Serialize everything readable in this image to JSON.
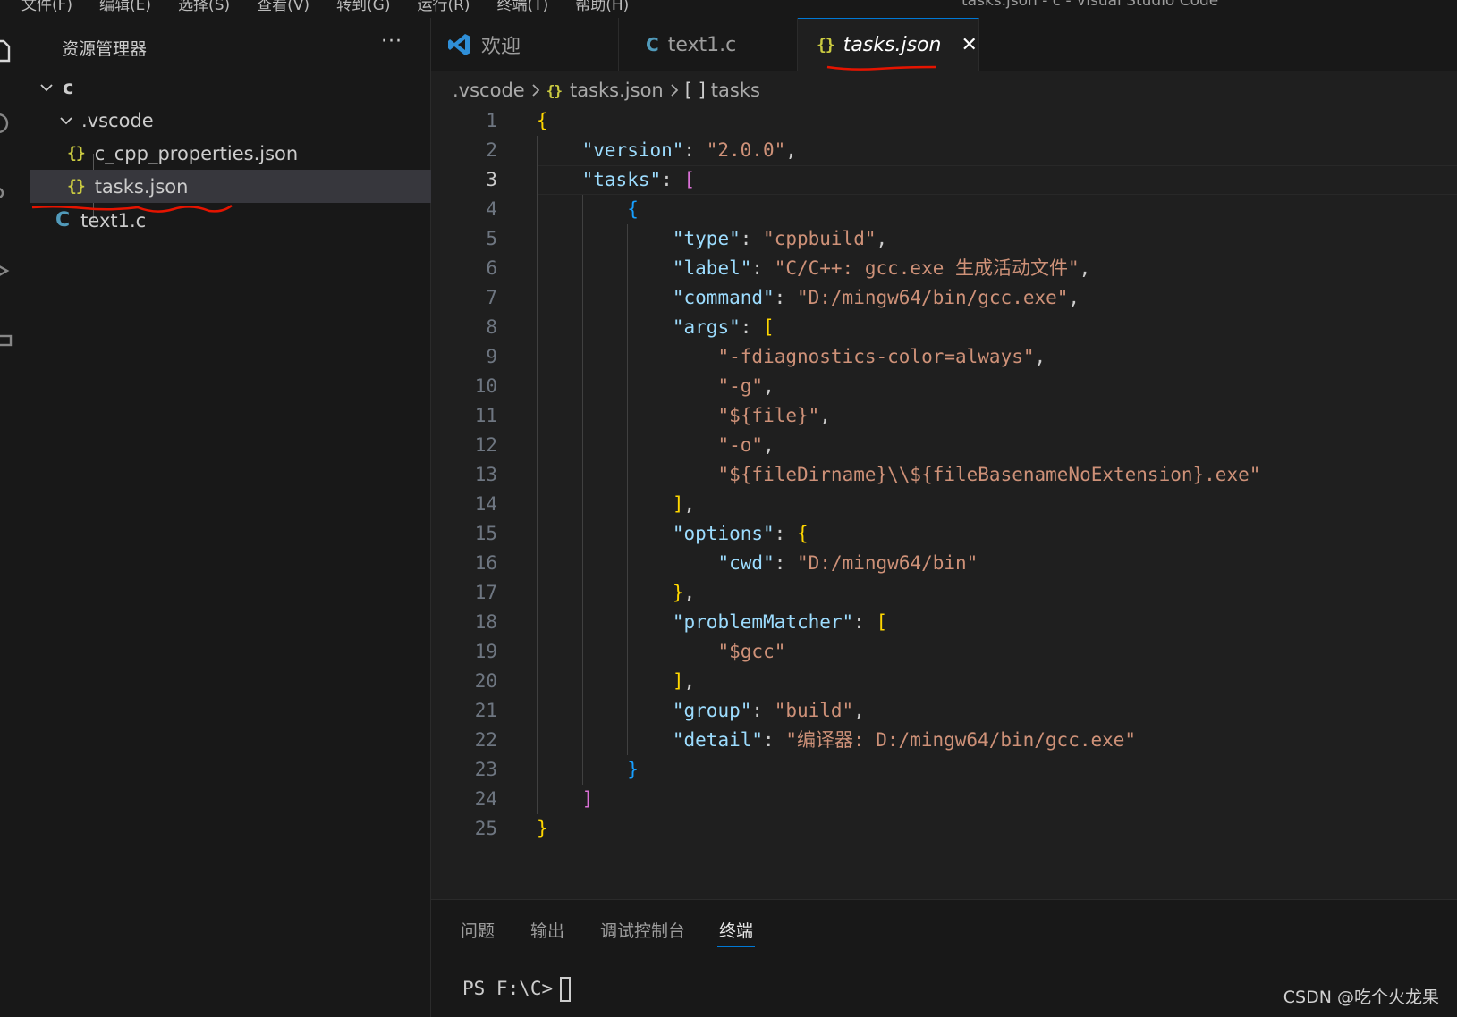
{
  "menubar": {
    "items": [
      "文件(F)",
      "编辑(E)",
      "选择(S)",
      "查看(V)",
      "转到(G)",
      "运行(R)",
      "终端(T)",
      "帮助(H)"
    ],
    "window_title": "tasks.json - c - Visual Studio Code"
  },
  "sidebar": {
    "title": "资源管理器",
    "more": "···",
    "tree": [
      {
        "label": "c",
        "type": "folder",
        "expanded": true,
        "depth": 0
      },
      {
        "label": ".vscode",
        "type": "folder",
        "expanded": true,
        "depth": 1
      },
      {
        "label": "c_cpp_properties.json",
        "type": "json",
        "depth": 2
      },
      {
        "label": "tasks.json",
        "type": "json",
        "depth": 2,
        "selected": true
      },
      {
        "label": "text1.c",
        "type": "c",
        "depth": 1
      }
    ],
    "icons": {
      "json": "{}",
      "c": "C"
    }
  },
  "tabs": [
    {
      "label": "欢迎",
      "icon": "vscode-logo-icon",
      "active": false
    },
    {
      "label": "text1.c",
      "icon": "c-file-icon",
      "active": false
    },
    {
      "label": "tasks.json",
      "icon": "json-file-icon",
      "active": true,
      "close": "✕"
    }
  ],
  "breadcrumb": {
    "folder": ".vscode",
    "file": "tasks.json",
    "symbol_icon": "[ ]",
    "symbol": "tasks",
    "json_icon": "{}"
  },
  "editor": {
    "current_line": 3,
    "lines": [
      "{",
      "    \"version\": \"2.0.0\",",
      "    \"tasks\": [",
      "        {",
      "            \"type\": \"cppbuild\",",
      "            \"label\": \"C/C++: gcc.exe 生成活动文件\",",
      "            \"command\": \"D:/mingw64/bin/gcc.exe\",",
      "            \"args\": [",
      "                \"-fdiagnostics-color=always\",",
      "                \"-g\",",
      "                \"${file}\",",
      "                \"-o\",",
      "                \"${fileDirname}\\\\${fileBasenameNoExtension}.exe\"",
      "            ],",
      "            \"options\": {",
      "                \"cwd\": \"D:/mingw64/bin\"",
      "            },",
      "            \"problemMatcher\": [",
      "                \"$gcc\"",
      "            ],",
      "            \"group\": \"build\",",
      "            \"detail\": \"编译器: D:/mingw64/bin/gcc.exe\"",
      "        }",
      "    ]",
      "}"
    ]
  },
  "panel": {
    "tabs": [
      "问题",
      "输出",
      "调试控制台",
      "终端"
    ],
    "active_tab": "终端",
    "terminal_prompt": "PS F:\\C>"
  },
  "watermark": "CSDN @吃个火龙果",
  "colors": {
    "accent": "#0078d4",
    "annotation": "#e51400",
    "key": "#9cdcfe",
    "string": "#ce9178",
    "bracket1": "#ffd700",
    "bracket2": "#da70d6",
    "bracket3": "#179fff"
  }
}
